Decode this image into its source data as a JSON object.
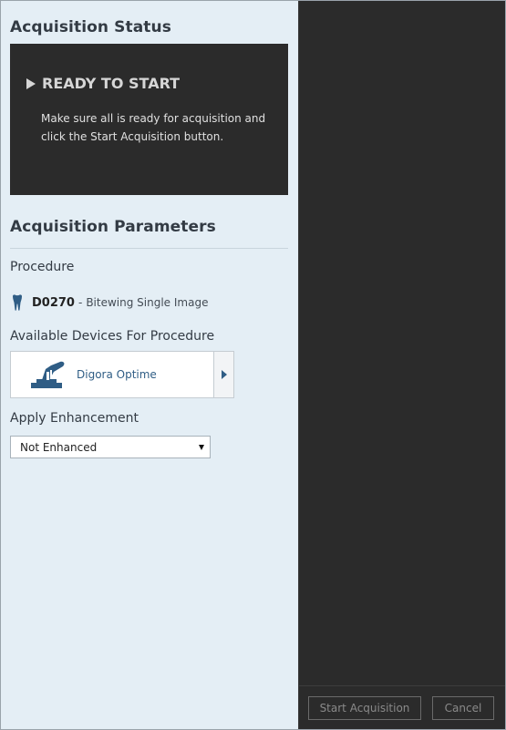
{
  "acquisition_status": {
    "title": "Acquisition Status",
    "heading": "READY TO START",
    "message": "Make sure all is ready for acquisition and click the Start Acquisition button."
  },
  "acquisition_parameters": {
    "title": "Acquisition Parameters",
    "procedure_label": "Procedure",
    "procedure": {
      "code": "D0270",
      "separator": "-",
      "description": "Bitewing Single Image",
      "icon": "tooth-icon"
    },
    "devices_label": "Available Devices For Procedure",
    "device": {
      "name": "Digora Optime",
      "icon": "scanner-icon"
    },
    "enhancement_label": "Apply Enhancement",
    "enhancement_selected": "Not Enhanced"
  },
  "footer": {
    "start_label": "Start Acquisition",
    "cancel_label": "Cancel"
  },
  "colors": {
    "left_panel_bg": "#e4eef5",
    "dark_bg": "#2b2b2b",
    "accent_blue": "#2f5d85"
  }
}
